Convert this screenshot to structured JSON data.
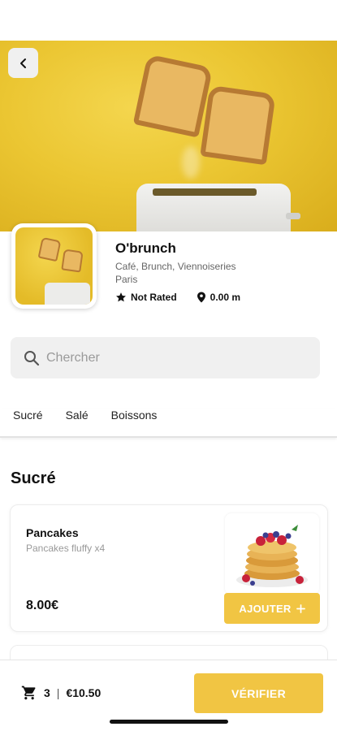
{
  "restaurant": {
    "name": "O'brunch",
    "categories": "Café, Brunch, Viennoiseries",
    "city": "Paris",
    "rating": "Not Rated",
    "distance": "0.00 m"
  },
  "search": {
    "placeholder": "Chercher"
  },
  "tabs": [
    {
      "label": "Sucré"
    },
    {
      "label": "Salé"
    },
    {
      "label": "Boissons"
    }
  ],
  "section": {
    "title": "Sucré"
  },
  "products": [
    {
      "name": "Pancakes",
      "description": "Pancakes fluffy x4",
      "price": "8.00€",
      "add_label": "AJOUTER"
    }
  ],
  "cart": {
    "count": "3",
    "separator": "|",
    "total": "€10.50",
    "checkout_label": "VÉRIFIER"
  },
  "colors": {
    "accent": "#f1c543",
    "hero_yellow": "#ebc632"
  },
  "icons": {
    "back": "chevron-left-icon",
    "rating": "star-icon",
    "distance": "location-pin-icon",
    "search": "search-icon",
    "add": "plus-icon",
    "cart": "cart-icon"
  }
}
